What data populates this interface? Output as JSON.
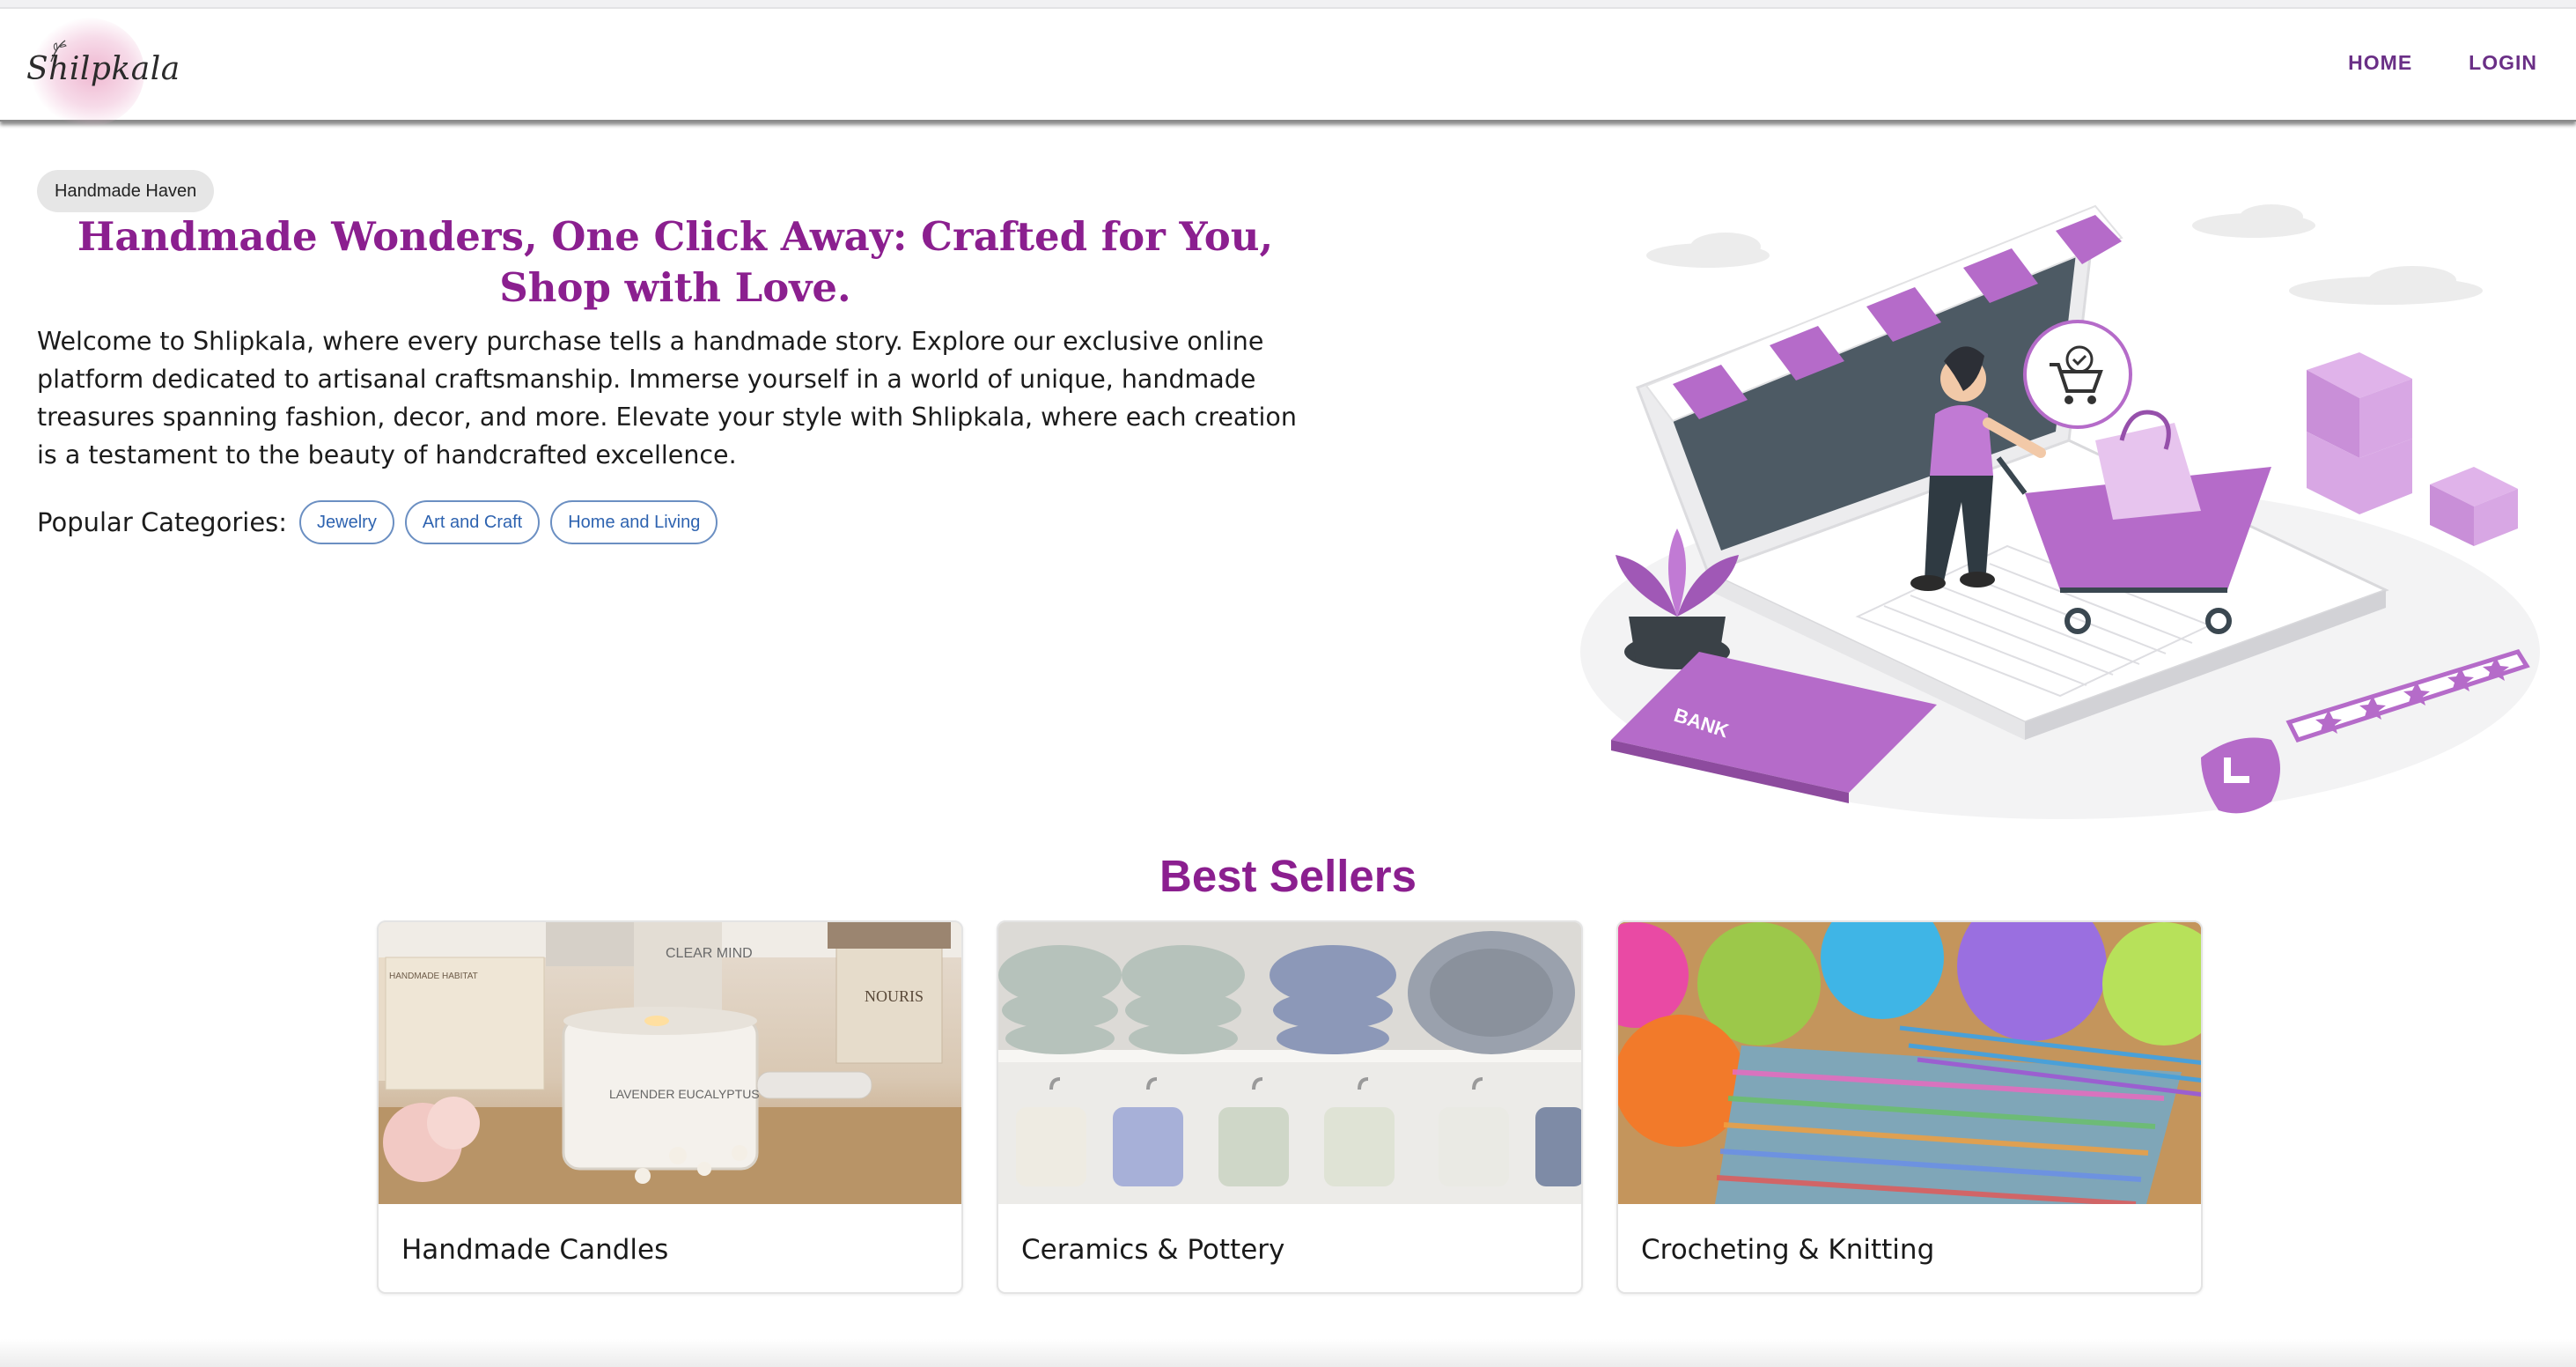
{
  "brand": {
    "name": "Shilpkala",
    "logo_icon": "flower-sprig-icon"
  },
  "nav": {
    "home": "HOME",
    "login": "LOGIN"
  },
  "hero": {
    "badge": "Handmade Haven",
    "headline": "Handmade Wonders, One Click Away: Crafted for You, Shop with Love.",
    "intro": "Welcome to Shlipkala, where every purchase tells a handmade story. Explore our exclusive online platform dedicated to artisanal craftsmanship. Immerse yourself in a world of unique, handmade treasures spanning fashion, decor, and more. Elevate your style with Shlipkala, where each creation is a testament to the beauty of handcrafted excellence.",
    "categories_label": "Popular Categories:",
    "categories": [
      "Jewelry",
      "Art and Craft",
      "Home and Living"
    ],
    "illustration": {
      "bank_label": "BANK",
      "rating_stars": 5,
      "icons": [
        "laptop-store-illustration",
        "cart-check-icon",
        "shopping-cart-icon",
        "bank-card-icon",
        "rating-stars-icon",
        "shield-check-icon",
        "parcel-boxes-icon",
        "potted-plant-icon"
      ]
    }
  },
  "best_sellers": {
    "title": "Best Sellers",
    "items": [
      {
        "caption": "Handmade Candles",
        "img_labels": [
          "CLEAR MIND",
          "HANDMADE HABITAT",
          "NOURIS",
          "LAVENDER EUCALYPTUS"
        ]
      },
      {
        "caption": "Ceramics & Pottery"
      },
      {
        "caption": "Crocheting & Knitting"
      }
    ]
  },
  "colors": {
    "accent_purple": "#8b1f8f",
    "nav_purple": "#6a2f86",
    "pill_blue": "#2e63b0",
    "illustration_violet": "#b56bc9"
  }
}
